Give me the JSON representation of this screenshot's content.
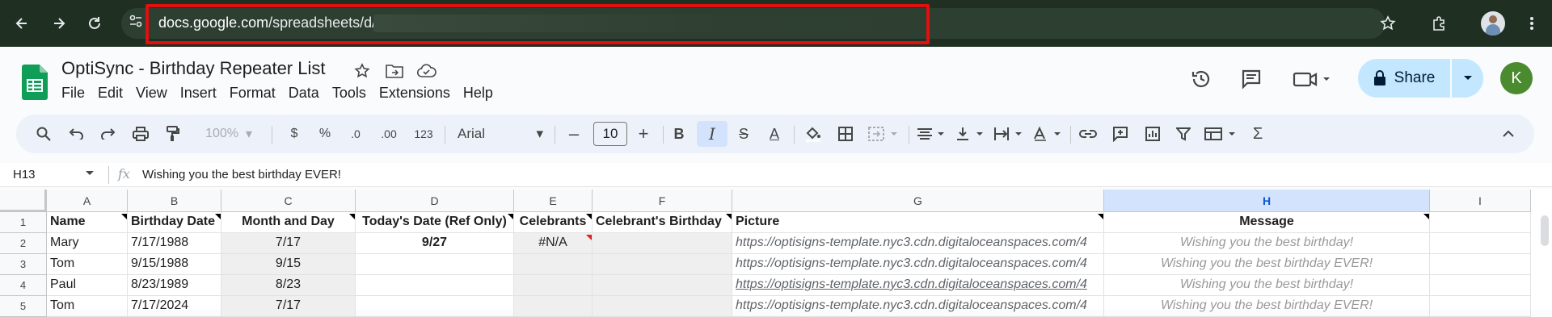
{
  "browser": {
    "url_host": "docs.google.com",
    "url_path": "/spreadsheets/d/"
  },
  "doc": {
    "title": "OptiSync - Birthday Repeater List",
    "menu": [
      "File",
      "Edit",
      "View",
      "Insert",
      "Format",
      "Data",
      "Tools",
      "Extensions",
      "Help"
    ],
    "share_label": "Share",
    "user_initial": "K"
  },
  "toolbar": {
    "zoom": "100%",
    "currency": "$",
    "percent": "%",
    "dec_decrease": ".0",
    "dec_increase": ".00",
    "number_format": "123",
    "font": "Arial",
    "font_size": "10",
    "bold": "B",
    "italic": "I",
    "strike": "S",
    "text_color": "A",
    "sigma": "Σ"
  },
  "formula_bar": {
    "cell_ref": "H13",
    "fx": "fx",
    "value": "Wishing you the best birthday EVER!"
  },
  "sheet": {
    "columns": [
      "A",
      "B",
      "C",
      "D",
      "E",
      "F",
      "G",
      "H",
      "I"
    ],
    "rows": [
      "1",
      "2",
      "3",
      "4",
      "5"
    ],
    "header_row": [
      "Name",
      "Birthday Date",
      "Month and Day",
      "Today's Date (Ref Only)",
      "Celebrants",
      "Celebrant's Birthday",
      "Picture",
      "Message",
      ""
    ],
    "data": [
      [
        "Mary",
        "7/17/1988",
        "7/17",
        "9/27",
        "#N/A",
        "",
        "https://optisigns-template.nyc3.cdn.digitaloceanspaces.com/4",
        "Wishing you the best birthday!",
        ""
      ],
      [
        "Tom",
        "9/15/1988",
        "9/15",
        "",
        "",
        "",
        "https://optisigns-template.nyc3.cdn.digitaloceanspaces.com/4",
        "Wishing you the best birthday EVER!",
        ""
      ],
      [
        "Paul",
        "8/23/1989",
        "8/23",
        "",
        "",
        "",
        "https://optisigns-template.nyc3.cdn.digitaloceanspaces.com/4",
        "Wishing you the best birthday!",
        ""
      ],
      [
        "Tom",
        "7/17/2024",
        "7/17",
        "",
        "",
        "",
        "https://optisigns-template.nyc3.cdn.digitaloceanspaces.com/4",
        "Wishing you the best birthday EVER!",
        ""
      ]
    ]
  },
  "colors": {
    "chrome_bg": "#1f3023",
    "url_highlight": "#e01010",
    "share_bg": "#c2e7ff",
    "selected_col": "#d3e3fd",
    "avatar_bg": "#4b8b2f"
  }
}
